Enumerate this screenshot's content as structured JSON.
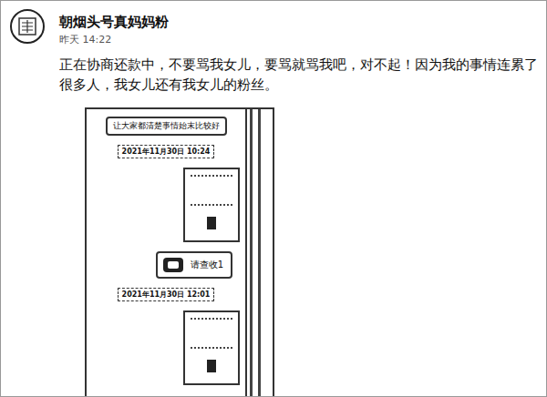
{
  "post": {
    "author": "朝烟头号真妈妈粉",
    "time": "昨天 14:22",
    "text": "正在协商还款中，不要骂我女儿，要骂就骂我吧，对不起！因为我的事情连累了很多人，我女儿还有我女儿的粉丝。"
  },
  "attachment": {
    "messages": [
      {
        "kind": "notice",
        "text": "让大家都清楚事情始末比较好"
      },
      {
        "kind": "timestamp",
        "text": "2021年11月30日 10:24"
      },
      {
        "kind": "image",
        "text": ""
      },
      {
        "kind": "text",
        "text": "请查收1"
      },
      {
        "kind": "timestamp",
        "text": "2021年11月30日 12:01"
      },
      {
        "kind": "image",
        "text": ""
      }
    ]
  }
}
